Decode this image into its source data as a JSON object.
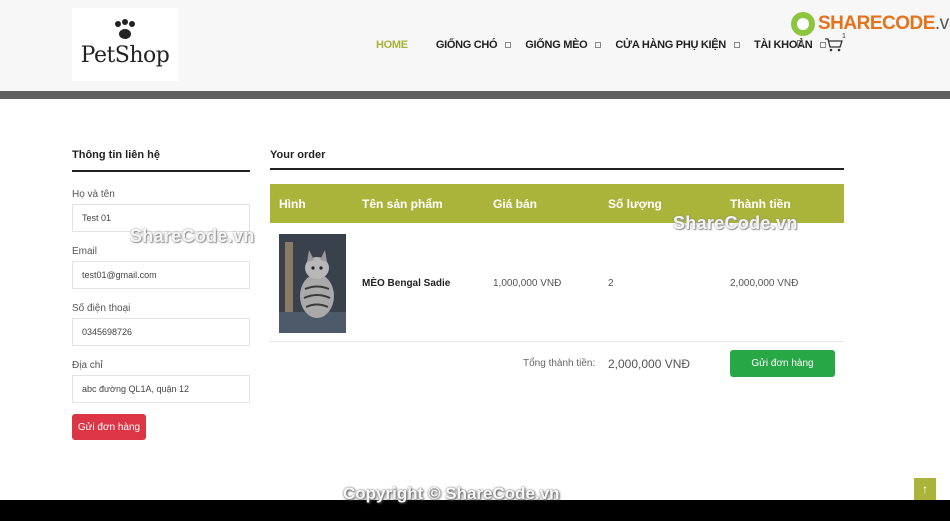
{
  "header": {
    "logo_text": "PetShop",
    "nav": [
      {
        "label": "HOME",
        "active": true
      },
      {
        "label": "GIỐNG CHÓ",
        "active": false
      },
      {
        "label": "GIỐNG MÈO",
        "active": false
      },
      {
        "label": "CỬA HÀNG PHỤ KIỆN",
        "active": false
      },
      {
        "label": "TÀI KHOẢN",
        "active": false
      }
    ],
    "cart_count": "1",
    "brand": {
      "name": "SHARECODE",
      "tld": ".vn"
    }
  },
  "contact": {
    "title": "Thông tin liên hệ",
    "fields": [
      {
        "label": "Họ và tên",
        "value": "Test 01"
      },
      {
        "label": "Email",
        "value": "test01@gmail.com"
      },
      {
        "label": "Số điện thoại",
        "value": "0345698726"
      },
      {
        "label": "Địa chỉ",
        "value": "abc đường QL1A, quận 12"
      }
    ],
    "submit_label": "Gửi đơn hàng"
  },
  "order": {
    "title": "Your order",
    "columns": [
      "Hình",
      "Tên sản phẩm",
      "Giá bán",
      "Số lượng",
      "Thành tiền"
    ],
    "rows": [
      {
        "image": "cat-photo",
        "name": "MÈO Bengal Sadie",
        "price": "1,000,000 VNĐ",
        "quantity": "2",
        "subtotal": "2,000,000 VNĐ"
      }
    ],
    "total_label": "Tổng thành tiền:",
    "total_value": "2,000,000 VNĐ",
    "submit_label": "Gửi đơn hàng"
  },
  "watermarks": [
    "ShareCode.vn",
    "ShareCode.vn"
  ],
  "footer": {
    "copyright": "Copyright © ShareCode.vn"
  },
  "colors": {
    "accent": "#aab43a",
    "submit_left": "#dc3545",
    "submit_right": "#28a745",
    "header_bar": "#5f5f5f"
  }
}
